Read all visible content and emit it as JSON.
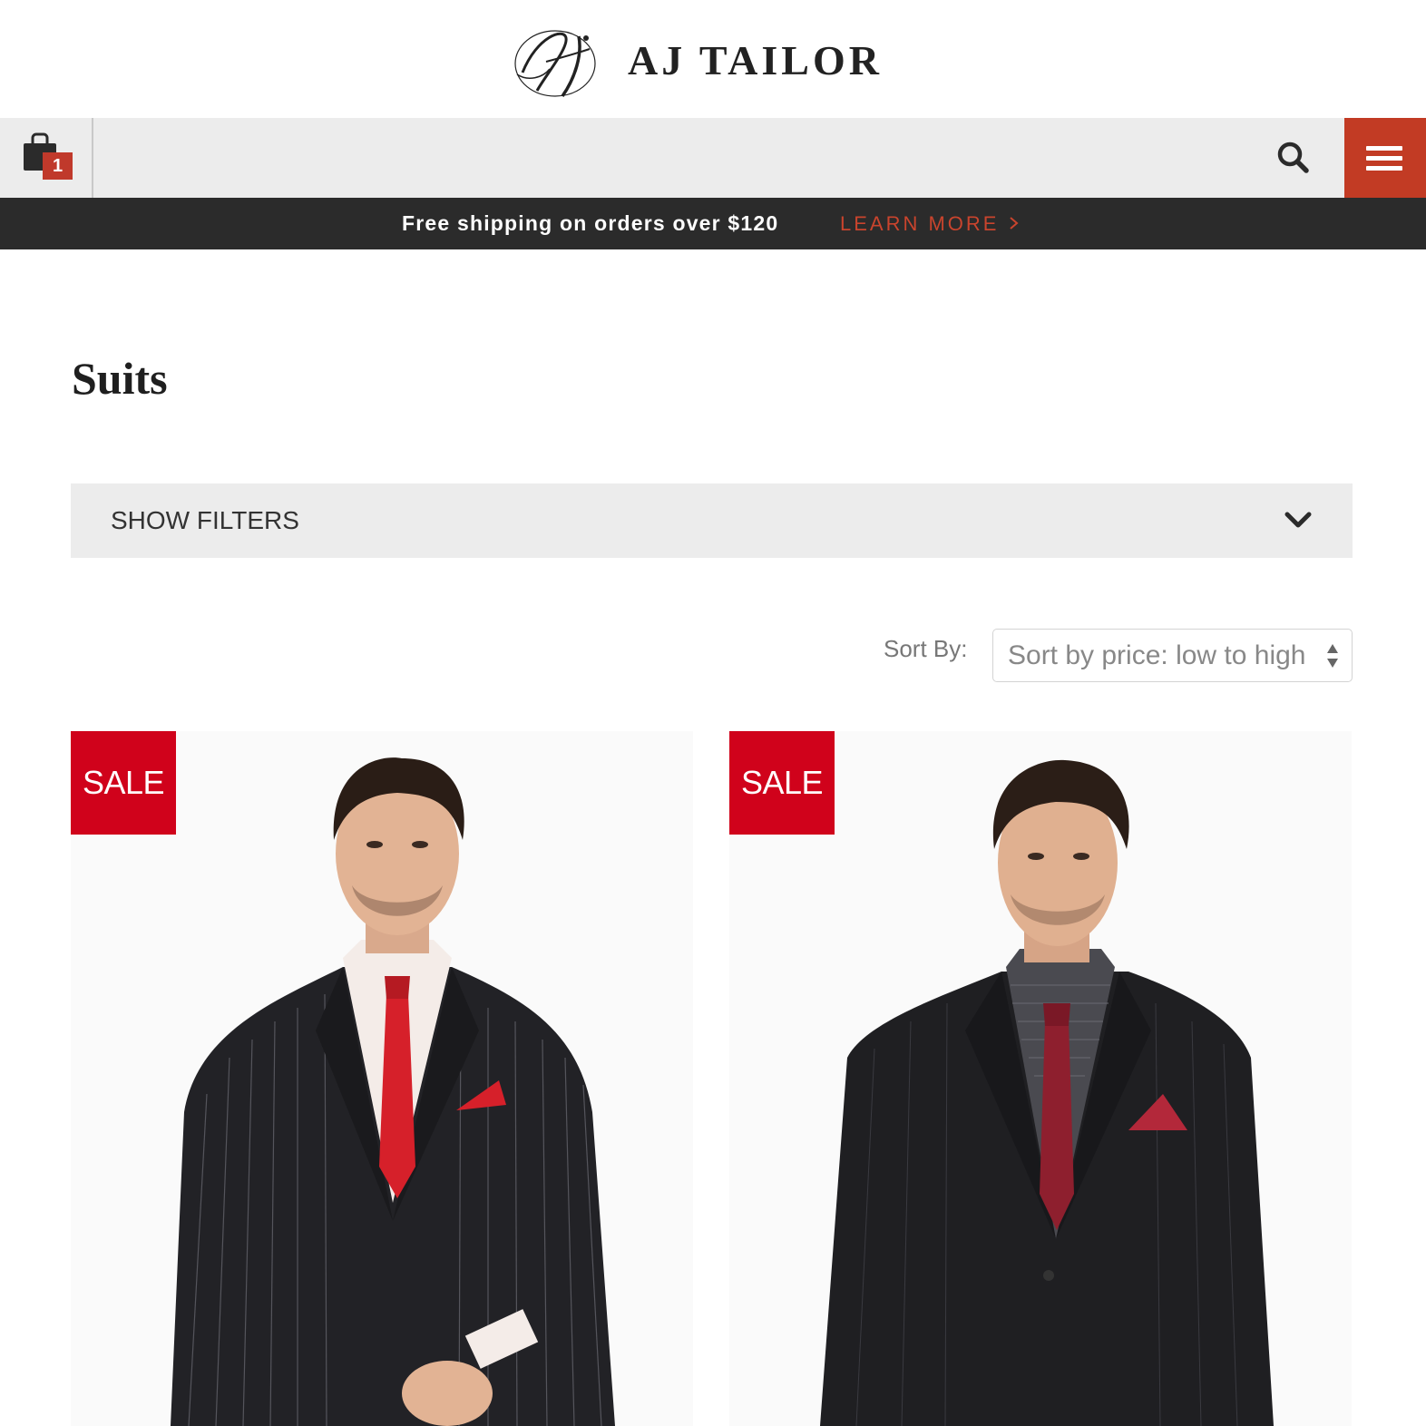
{
  "brand": {
    "name": "AJ TAILOR",
    "monogram": "Aj"
  },
  "nav": {
    "cart_count": "1",
    "icons": [
      "shopping-bag-icon",
      "search-icon",
      "hamburger-menu-icon"
    ],
    "menu_color": "#c23b24"
  },
  "promo": {
    "text": "Free shipping on orders over $120",
    "link": "LEARN MORE"
  },
  "page": {
    "title": "Suits"
  },
  "filters": {
    "label": "SHOW FILTERS"
  },
  "sort": {
    "label": "Sort By:",
    "selected": "Sort by price: low to high"
  },
  "products": [
    {
      "badge": "SALE",
      "tie_color": "#d6202a",
      "shirt": "white"
    },
    {
      "badge": "SALE",
      "tie_color": "#8e1f2e",
      "shirt": "checked"
    }
  ],
  "colors": {
    "sale": "#d0021b",
    "accent": "#c9442d",
    "promo_bg": "#2b2b2b",
    "nav_bg": "#ececec"
  }
}
